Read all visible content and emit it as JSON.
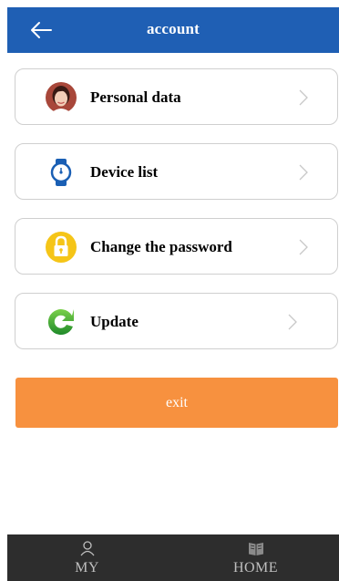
{
  "header": {
    "title": "account",
    "back_icon": "arrow-left-icon",
    "color": "#1f5fb4"
  },
  "menu": [
    {
      "label": "Personal data",
      "icon": "avatar-icon"
    },
    {
      "label": "Device list",
      "icon": "watch-icon"
    },
    {
      "label": "Change the password",
      "icon": "lock-icon"
    },
    {
      "label": "Update",
      "icon": "refresh-icon"
    }
  ],
  "exit_button": {
    "label": "exit",
    "color": "#f7913f"
  },
  "tabbar": {
    "tabs": [
      {
        "label": "MY",
        "icon": "person-icon"
      },
      {
        "label": "HOME",
        "icon": "book-icon"
      }
    ],
    "color": "#2d2d2d"
  }
}
